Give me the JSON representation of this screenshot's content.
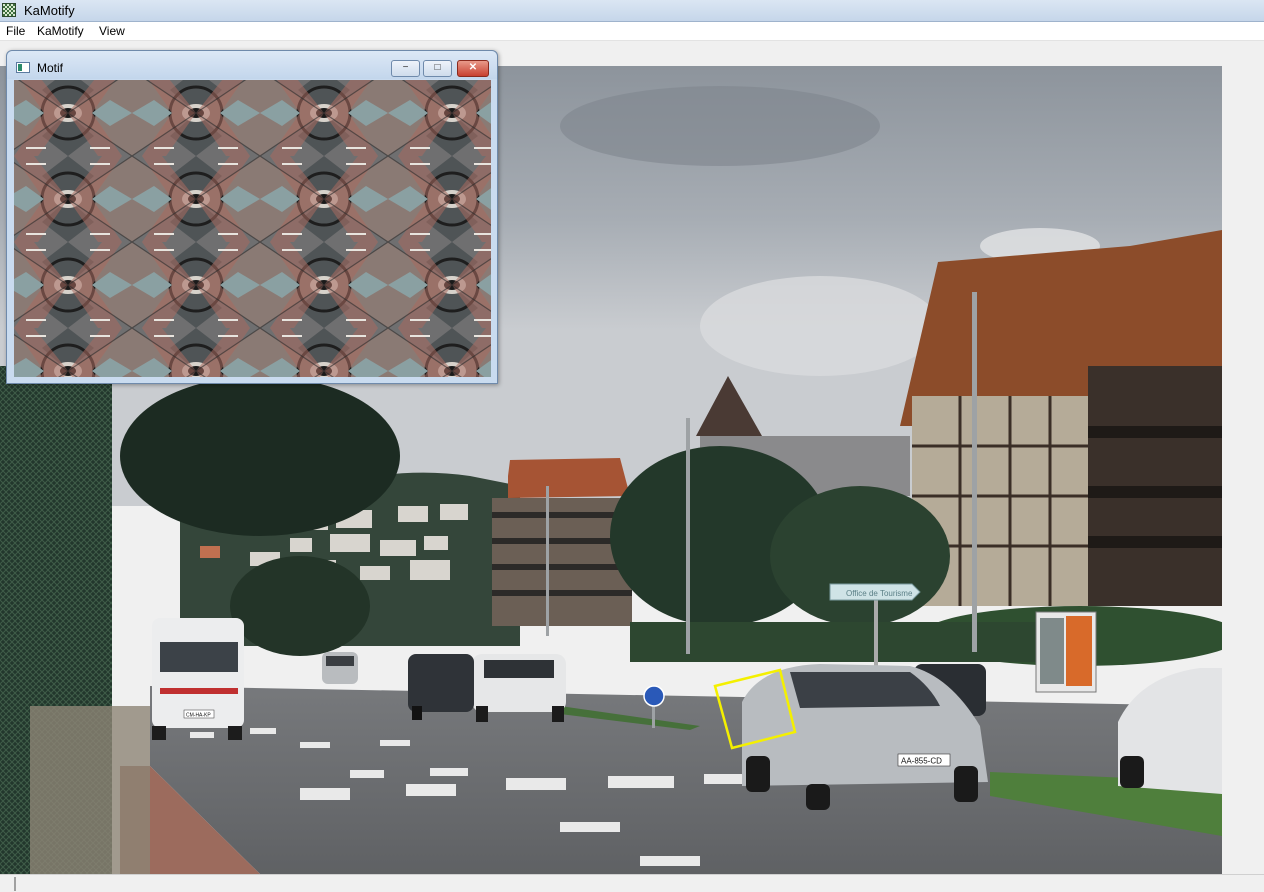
{
  "window": {
    "title": "KaMotify",
    "icon": "app-icon"
  },
  "menubar": {
    "items": [
      "File",
      "KaMotify",
      "View"
    ]
  },
  "motif_window": {
    "title": "Motif",
    "icon": "window-icon",
    "minimize_glyph": "−",
    "maximize_glyph": "□",
    "close_glyph": "✕"
  },
  "photo": {
    "van_plate": "CM-HA-KP",
    "car_plate": "AA-855-CD",
    "sign_text": "Office de Tourisme",
    "selection_color": "#f4f000"
  },
  "colors": {
    "titlebar": "#c6d6ea",
    "motif_frame": "#c9dbef",
    "close_button": "#c84030"
  }
}
